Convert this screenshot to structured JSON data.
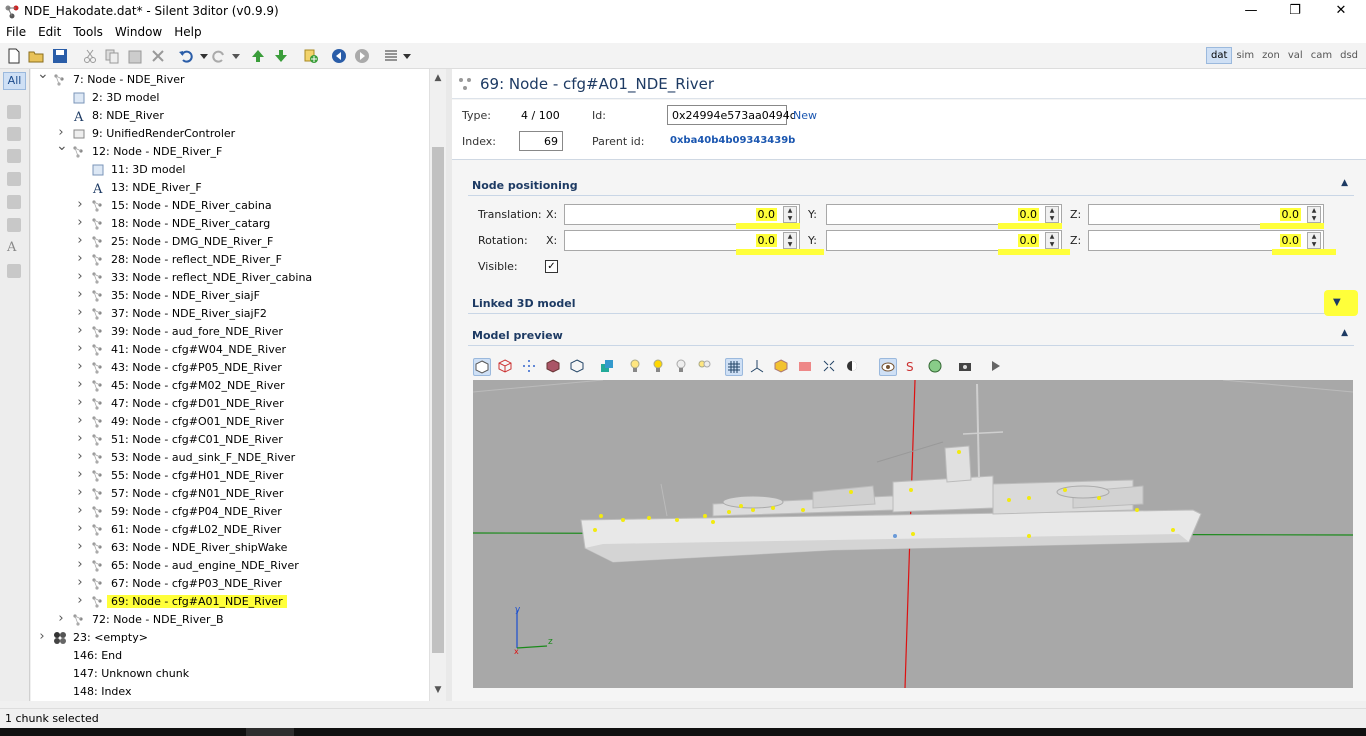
{
  "window": {
    "title": "NDE_Hakodate.dat* - Silent 3ditor (v0.9.9)",
    "minimize": "—",
    "maximize": "❐",
    "close": "✕"
  },
  "menu": [
    "File",
    "Edit",
    "Tools",
    "Window",
    "Help"
  ],
  "view_tabs": [
    "dat",
    "sim",
    "zon",
    "val",
    "cam",
    "dsd"
  ],
  "active_view_tab": "dat",
  "left_filter": "All",
  "tree": [
    {
      "label": "7: Node - NDE_River",
      "icon": "node-icon",
      "expander": "expanded"
    },
    {
      "label": "2: 3D model",
      "icon": "model-icon",
      "expander": "none"
    },
    {
      "label": "8: NDE_River",
      "icon": "text-icon",
      "expander": "none"
    },
    {
      "label": "9: UnifiedRenderControler",
      "icon": "controller-icon",
      "expander": "collapsed"
    },
    {
      "label": "12: Node - NDE_River_F",
      "icon": "node-icon",
      "expander": "expanded"
    },
    {
      "label": "11: 3D model",
      "icon": "model-icon",
      "expander": "none"
    },
    {
      "label": "13: NDE_River_F",
      "icon": "text-icon",
      "expander": "none"
    },
    {
      "label": "15: Node - NDE_River_cabina",
      "icon": "node-icon",
      "expander": "collapsed"
    },
    {
      "label": "18: Node - NDE_River_catarg",
      "icon": "node-icon",
      "expander": "collapsed"
    },
    {
      "label": "25: Node - DMG_NDE_River_F",
      "icon": "node-icon",
      "expander": "collapsed"
    },
    {
      "label": "28: Node - reflect_NDE_River_F",
      "icon": "node-icon",
      "expander": "collapsed"
    },
    {
      "label": "33: Node - reflect_NDE_River_cabina",
      "icon": "node-icon",
      "expander": "collapsed"
    },
    {
      "label": "35: Node - NDE_River_siajF",
      "icon": "node-icon",
      "expander": "collapsed"
    },
    {
      "label": "37: Node - NDE_River_siajF2",
      "icon": "node-icon",
      "expander": "collapsed"
    },
    {
      "label": "39: Node - aud_fore_NDE_River",
      "icon": "node-icon",
      "expander": "collapsed"
    },
    {
      "label": "41: Node - cfg#W04_NDE_River",
      "icon": "node-icon",
      "expander": "collapsed"
    },
    {
      "label": "43: Node - cfg#P05_NDE_River",
      "icon": "node-icon",
      "expander": "collapsed"
    },
    {
      "label": "45: Node - cfg#M02_NDE_River",
      "icon": "node-icon",
      "expander": "collapsed"
    },
    {
      "label": "47: Node - cfg#D01_NDE_River",
      "icon": "node-icon",
      "expander": "collapsed"
    },
    {
      "label": "49: Node - cfg#O01_NDE_River",
      "icon": "node-icon",
      "expander": "collapsed"
    },
    {
      "label": "51: Node - cfg#C01_NDE_River",
      "icon": "node-icon",
      "expander": "collapsed"
    },
    {
      "label": "53: Node - aud_sink_F_NDE_River",
      "icon": "node-icon",
      "expander": "collapsed"
    },
    {
      "label": "55: Node - cfg#H01_NDE_River",
      "icon": "node-icon",
      "expander": "collapsed"
    },
    {
      "label": "57: Node - cfg#N01_NDE_River",
      "icon": "node-icon",
      "expander": "collapsed"
    },
    {
      "label": "59: Node - cfg#P04_NDE_River",
      "icon": "node-icon",
      "expander": "collapsed"
    },
    {
      "label": "61: Node - cfg#L02_NDE_River",
      "icon": "node-icon",
      "expander": "collapsed"
    },
    {
      "label": "63: Node - NDE_River_shipWake",
      "icon": "node-icon",
      "expander": "collapsed"
    },
    {
      "label": "65: Node - aud_engine_NDE_River",
      "icon": "node-icon",
      "expander": "collapsed"
    },
    {
      "label": "67: Node - cfg#P03_NDE_River",
      "icon": "node-icon",
      "expander": "collapsed"
    },
    {
      "label": "69: Node - cfg#A01_NDE_River",
      "icon": "node-icon",
      "expander": "collapsed",
      "selected": true
    },
    {
      "label": "72: Node - NDE_River_B",
      "icon": "node-icon",
      "expander": "collapsed"
    },
    {
      "label": "23: <empty>",
      "icon": "group-icon",
      "expander": "collapsed"
    },
    {
      "label": "146: End",
      "icon": "none",
      "expander": "none"
    },
    {
      "label": "147: Unknown chunk",
      "icon": "none",
      "expander": "none"
    },
    {
      "label": "148: Index",
      "icon": "none",
      "expander": "none"
    }
  ],
  "panel": {
    "title": "69: Node - cfg#A01_NDE_River",
    "type_label": "Type:",
    "type_value": "4 / 100",
    "id_label": "Id:",
    "id_value": "0x24994e573aa0494c",
    "new_link": "New",
    "index_label": "Index:",
    "index_value": "69",
    "parent_label": "Parent id:",
    "parent_value": "0xba40b4b09343439b"
  },
  "node_positioning": {
    "title": "Node positioning",
    "translation_label": "Translation:",
    "rotation_label": "Rotation:",
    "visible_label": "Visible:",
    "x_label": "X:",
    "y_label": "Y:",
    "z_label": "Z:",
    "translation": {
      "x": "0.0",
      "y": "0.0",
      "z": "0.0"
    },
    "rotation": {
      "x": "0.0",
      "y": "0.0",
      "z": "0.0"
    },
    "visible": true
  },
  "linked_model": {
    "title": "Linked 3D model"
  },
  "model_preview": {
    "title": "Model preview",
    "axis_y": "y",
    "axis_z": "z",
    "axis_x": "x"
  },
  "status": "1 chunk selected",
  "colors": {
    "highlight": "#ffff3a",
    "accent": "#1d3a63",
    "link": "#1a56b0"
  }
}
